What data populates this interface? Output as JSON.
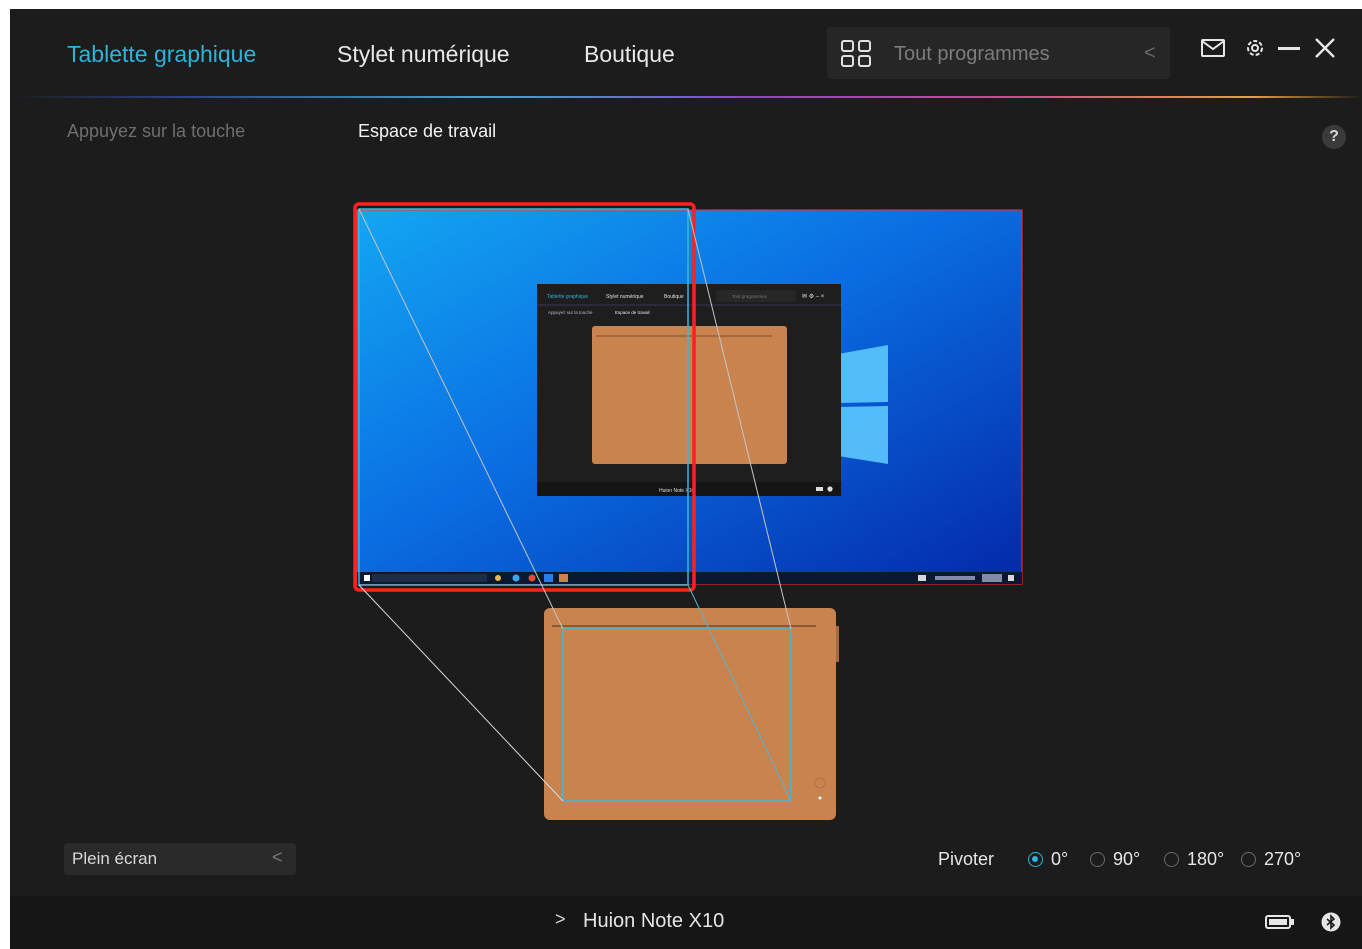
{
  "nav": {
    "tabs": [
      {
        "label": "Tablette graphique",
        "active": true
      },
      {
        "label": "Stylet numérique",
        "active": false
      },
      {
        "label": "Boutique",
        "active": false
      }
    ],
    "program_selector": {
      "label": "Tout programmes",
      "icon": "grid-icon"
    }
  },
  "window_controls": {
    "mail": "mail-icon",
    "settings": "gear-icon",
    "minimize": "minimize-icon",
    "close": "close-icon"
  },
  "subtabs": [
    {
      "label": "Appuyez sur la touche",
      "active": false
    },
    {
      "label": "Espace de travail",
      "active": true
    }
  ],
  "help_label": "?",
  "screen_preview": {
    "mini_app": {
      "tabs": [
        "Tablette graphique",
        "Stylet numérique",
        "Boutique"
      ],
      "program": "Tout programmes",
      "subtabs": [
        "Appuyez sur la touche",
        "Espace de travail"
      ],
      "device": "Huion Note X10"
    }
  },
  "mapping": {
    "mode_label": "Plein écran",
    "rotate_label": "Pivoter",
    "rotations": [
      {
        "label": "0°",
        "selected": true
      },
      {
        "label": "90°",
        "selected": false
      },
      {
        "label": "180°",
        "selected": false
      },
      {
        "label": "270°",
        "selected": false
      }
    ]
  },
  "footer": {
    "device_name": "Huion Note X10",
    "battery": "battery-icon",
    "bluetooth": "bluetooth-icon"
  },
  "colors": {
    "accent": "#2fb3d8",
    "tablet": "#c8834f",
    "selection": "#ff2a2a",
    "background": "#1c1c1c"
  }
}
